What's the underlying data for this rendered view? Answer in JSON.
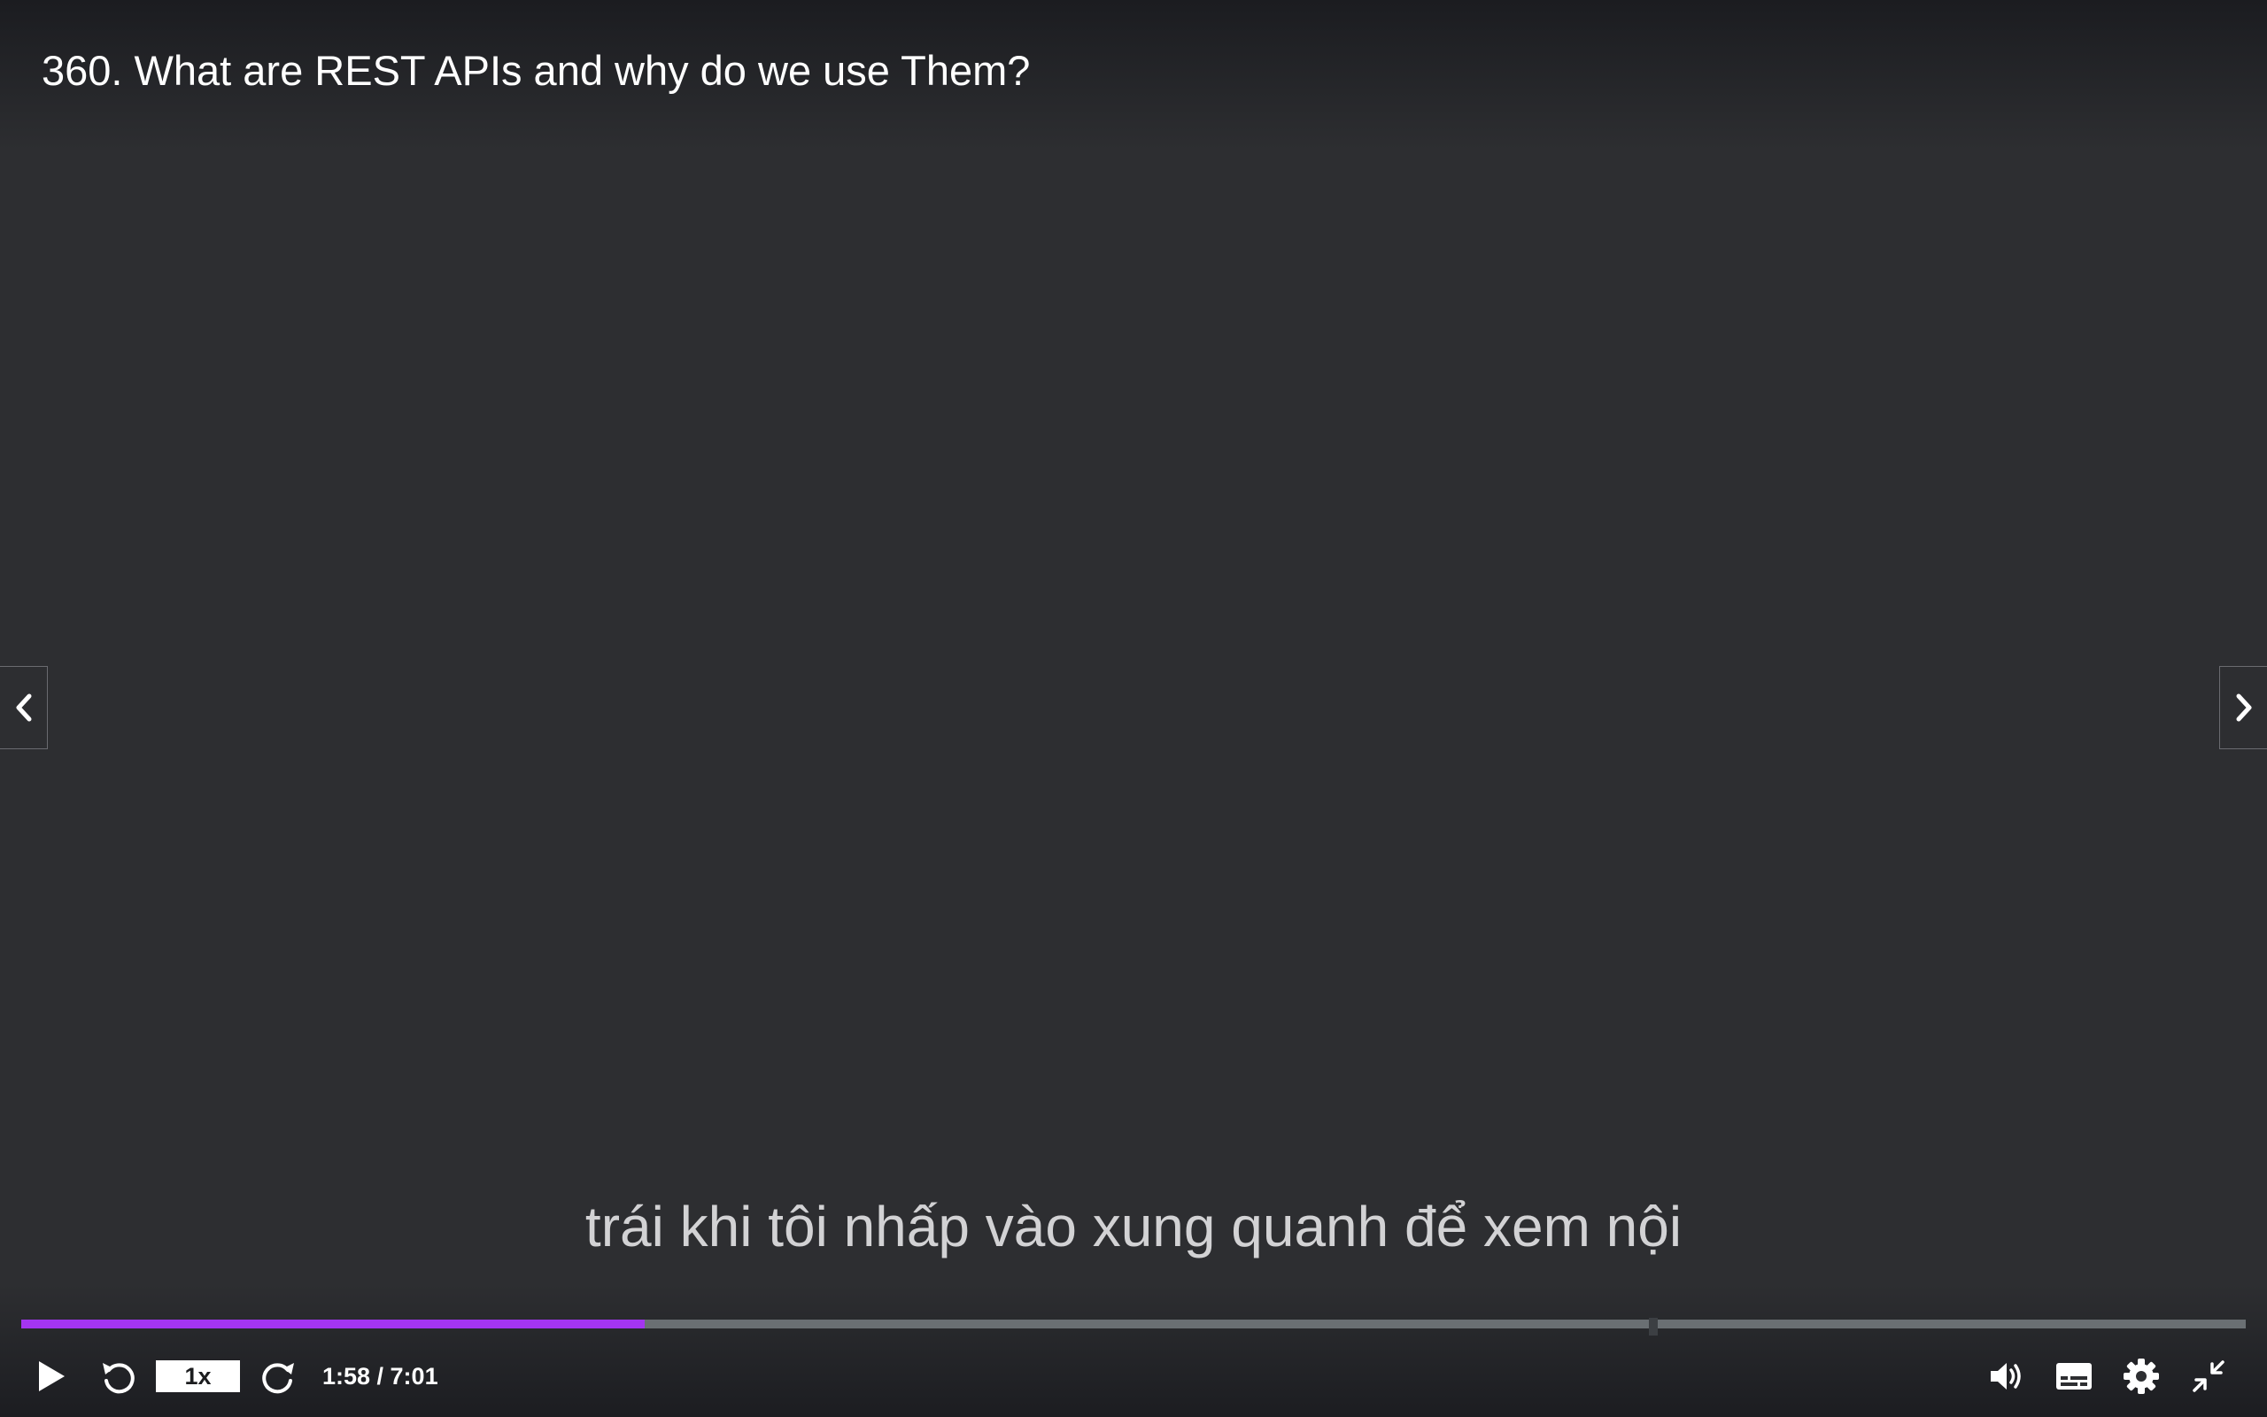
{
  "lecture": {
    "title": "360. What are REST APIs and why do we use Them?"
  },
  "caption": {
    "text": "trái khi tôi nhấp vào xung quanh để xem nội"
  },
  "playback": {
    "current_time": "1:58",
    "duration": "7:01",
    "time_display": "1:58 / 7:01",
    "speed_label": "1x",
    "progress_fraction": 0.2803,
    "marker_fraction": 0.7338
  },
  "icons": {
    "previous": "chevron-left-icon",
    "next": "chevron-right-icon",
    "play": "play-icon",
    "rewind": "rewind-5-icon",
    "forward": "forward-5-icon",
    "volume": "volume-icon",
    "captions": "captions-icon",
    "settings": "gear-icon",
    "exit_fullscreen": "exit-fullscreen-icon"
  },
  "colors": {
    "background": "#2d2e31",
    "accent": "#a435f0",
    "track": "#6a6f73",
    "caption_text": "#d2d2d4"
  }
}
